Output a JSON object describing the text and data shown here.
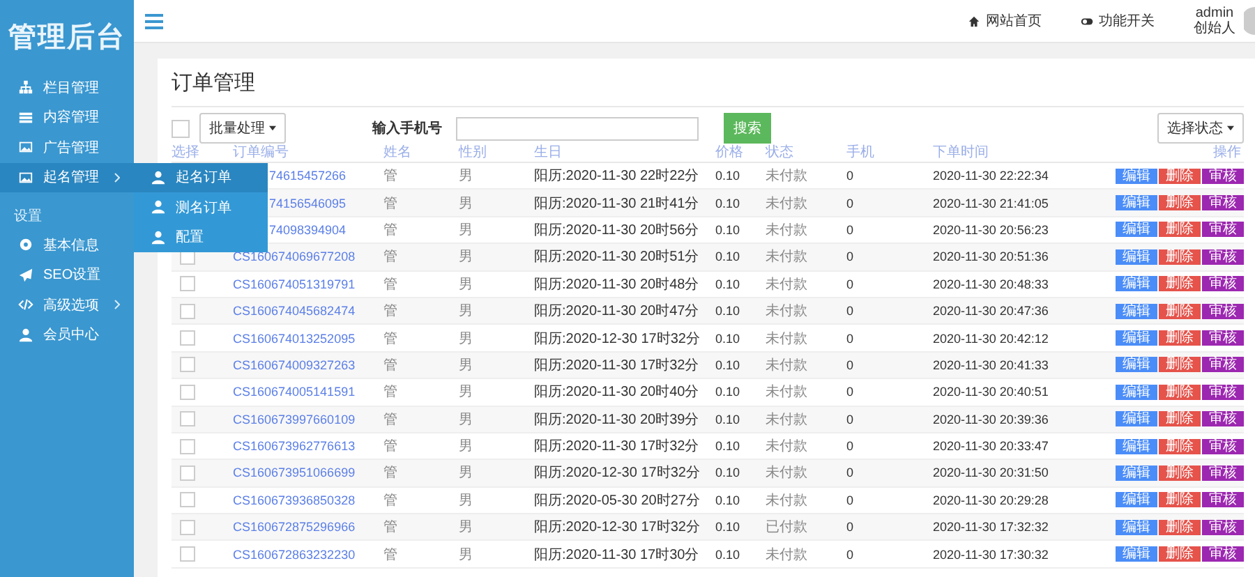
{
  "sidebar": {
    "logo": "管理后台",
    "items": [
      {
        "label": "栏目管理",
        "selected": false,
        "arrow": false
      },
      {
        "label": "内容管理",
        "selected": false,
        "arrow": false
      },
      {
        "label": "广告管理",
        "selected": false,
        "arrow": false
      },
      {
        "label": "起名管理",
        "selected": true,
        "arrow": true
      }
    ],
    "section": "设置",
    "settings": [
      {
        "label": "基本信息",
        "selected": false,
        "arrow": false
      },
      {
        "label": "SEO设置",
        "selected": false,
        "arrow": false
      },
      {
        "label": "高级选项",
        "selected": false,
        "arrow": true
      },
      {
        "label": "会员中心",
        "selected": false,
        "arrow": false
      }
    ],
    "flyout": [
      {
        "label": "起名订单",
        "selected": true
      },
      {
        "label": "测名订单",
        "selected": false
      },
      {
        "label": "配置",
        "selected": false
      }
    ]
  },
  "topbar": {
    "links": [
      {
        "label": "网站首页"
      },
      {
        "label": "功能开关"
      }
    ],
    "user": {
      "name": "admin",
      "role": "创始人"
    }
  },
  "page": {
    "title": "订单管理",
    "select_all": {
      "checked": false
    },
    "batch": "批量处理",
    "phone_label": "输入手机号",
    "search": "搜索",
    "status_filter": "选择状态"
  },
  "table": {
    "columns": [
      "选择",
      "订单编号",
      "姓名",
      "性别",
      "生日",
      "价格",
      "状态",
      "手机",
      "下单时间",
      "操作"
    ],
    "rows": [
      {
        "order_no": "74615457266",
        "name": "管",
        "gender": "男",
        "birthday": "阳历:2020-11-30 22时22分",
        "price": "0.10",
        "status": "未付款",
        "phone": "0",
        "time": "2020-11-30 22:22:34",
        "actions": [
          {
            "label": "编辑",
            "kind": "edit"
          },
          {
            "label": "删除",
            "kind": "delete"
          },
          {
            "label": "审核",
            "kind": "review"
          }
        ]
      },
      {
        "order_no": "74156546095",
        "name": "管",
        "gender": "男",
        "birthday": "阳历:2020-11-30 21时41分",
        "price": "0.10",
        "status": "未付款",
        "phone": "0",
        "time": "2020-11-30 21:41:05",
        "actions": [
          {
            "label": "编辑",
            "kind": "edit"
          },
          {
            "label": "删除",
            "kind": "delete"
          },
          {
            "label": "审核",
            "kind": "review"
          }
        ]
      },
      {
        "order_no": "74098394904",
        "name": "管",
        "gender": "男",
        "birthday": "阳历:2020-11-30 20时56分",
        "price": "0.10",
        "status": "未付款",
        "phone": "0",
        "time": "2020-11-30 20:56:23",
        "actions": [
          {
            "label": "编辑",
            "kind": "edit"
          },
          {
            "label": "删除",
            "kind": "delete"
          },
          {
            "label": "审核",
            "kind": "review"
          }
        ]
      },
      {
        "checked": false,
        "order_no": "CS160674069677208",
        "name": "管",
        "gender": "男",
        "birthday": "阳历:2020-11-30 20时51分",
        "price": "0.10",
        "status": "未付款",
        "phone": "0",
        "time": "2020-11-30 20:51:36",
        "actions": [
          {
            "label": "编辑",
            "kind": "edit"
          },
          {
            "label": "删除",
            "kind": "delete"
          },
          {
            "label": "审核",
            "kind": "review"
          }
        ]
      },
      {
        "checked": false,
        "order_no": "CS160674051319791",
        "name": "管",
        "gender": "男",
        "birthday": "阳历:2020-11-30 20时48分",
        "price": "0.10",
        "status": "未付款",
        "phone": "0",
        "time": "2020-11-30 20:48:33",
        "actions": [
          {
            "label": "编辑",
            "kind": "edit"
          },
          {
            "label": "删除",
            "kind": "delete"
          },
          {
            "label": "审核",
            "kind": "review"
          }
        ]
      },
      {
        "checked": false,
        "order_no": "CS160674045682474",
        "name": "管",
        "gender": "男",
        "birthday": "阳历:2020-11-30 20时47分",
        "price": "0.10",
        "status": "未付款",
        "phone": "0",
        "time": "2020-11-30 20:47:36",
        "actions": [
          {
            "label": "编辑",
            "kind": "edit"
          },
          {
            "label": "删除",
            "kind": "delete"
          },
          {
            "label": "审核",
            "kind": "review"
          }
        ]
      },
      {
        "checked": false,
        "order_no": "CS160674013252095",
        "name": "管",
        "gender": "男",
        "birthday": "阳历:2020-12-30 17时32分",
        "price": "0.10",
        "status": "未付款",
        "phone": "0",
        "time": "2020-11-30 20:42:12",
        "actions": [
          {
            "label": "编辑",
            "kind": "edit"
          },
          {
            "label": "删除",
            "kind": "delete"
          },
          {
            "label": "审核",
            "kind": "review"
          }
        ]
      },
      {
        "checked": false,
        "order_no": "CS160674009327263",
        "name": "管",
        "gender": "男",
        "birthday": "阳历:2020-11-30 17时32分",
        "price": "0.10",
        "status": "未付款",
        "phone": "0",
        "time": "2020-11-30 20:41:33",
        "actions": [
          {
            "label": "编辑",
            "kind": "edit"
          },
          {
            "label": "删除",
            "kind": "delete"
          },
          {
            "label": "审核",
            "kind": "review"
          }
        ]
      },
      {
        "checked": false,
        "order_no": "CS160674005141591",
        "name": "管",
        "gender": "男",
        "birthday": "阳历:2020-11-30 20时40分",
        "price": "0.10",
        "status": "未付款",
        "phone": "0",
        "time": "2020-11-30 20:40:51",
        "actions": [
          {
            "label": "编辑",
            "kind": "edit"
          },
          {
            "label": "删除",
            "kind": "delete"
          },
          {
            "label": "审核",
            "kind": "review"
          }
        ]
      },
      {
        "checked": false,
        "order_no": "CS160673997660109",
        "name": "管",
        "gender": "男",
        "birthday": "阳历:2020-11-30 20时39分",
        "price": "0.10",
        "status": "未付款",
        "phone": "0",
        "time": "2020-11-30 20:39:36",
        "actions": [
          {
            "label": "编辑",
            "kind": "edit"
          },
          {
            "label": "删除",
            "kind": "delete"
          },
          {
            "label": "审核",
            "kind": "review"
          }
        ]
      },
      {
        "checked": false,
        "order_no": "CS160673962776613",
        "name": "管",
        "gender": "男",
        "birthday": "阳历:2020-11-30 17时32分",
        "price": "0.10",
        "status": "未付款",
        "phone": "0",
        "time": "2020-11-30 20:33:47",
        "actions": [
          {
            "label": "编辑",
            "kind": "edit"
          },
          {
            "label": "删除",
            "kind": "delete"
          },
          {
            "label": "审核",
            "kind": "review"
          }
        ]
      },
      {
        "checked": false,
        "order_no": "CS160673951066699",
        "name": "管",
        "gender": "男",
        "birthday": "阳历:2020-12-30 17时32分",
        "price": "0.10",
        "status": "未付款",
        "phone": "0",
        "time": "2020-11-30 20:31:50",
        "actions": [
          {
            "label": "编辑",
            "kind": "edit"
          },
          {
            "label": "删除",
            "kind": "delete"
          },
          {
            "label": "审核",
            "kind": "review"
          }
        ]
      },
      {
        "checked": false,
        "order_no": "CS160673936850328",
        "name": "管",
        "gender": "男",
        "birthday": "阳历:2020-05-30 20时27分",
        "price": "0.10",
        "status": "未付款",
        "phone": "0",
        "time": "2020-11-30 20:29:28",
        "actions": [
          {
            "label": "编辑",
            "kind": "edit"
          },
          {
            "label": "删除",
            "kind": "delete"
          },
          {
            "label": "审核",
            "kind": "review"
          }
        ]
      },
      {
        "checked": false,
        "order_no": "CS160672875296966",
        "name": "管",
        "gender": "男",
        "birthday": "阳历:2020-12-30 17时32分",
        "price": "0.10",
        "status": "已付款",
        "phone": "0",
        "time": "2020-11-30 17:32:32",
        "actions": [
          {
            "label": "编辑",
            "kind": "edit"
          },
          {
            "label": "删除",
            "kind": "delete"
          },
          {
            "label": "审核",
            "kind": "review"
          }
        ]
      },
      {
        "checked": false,
        "order_no": "CS160672863232230",
        "name": "管",
        "gender": "男",
        "birthday": "阳历:2020-11-30 17时30分",
        "price": "0.10",
        "status": "未付款",
        "phone": "0",
        "time": "2020-11-30 17:30:32",
        "actions": [
          {
            "label": "编辑",
            "kind": "edit"
          },
          {
            "label": "删除",
            "kind": "delete"
          },
          {
            "label": "审核",
            "kind": "review"
          }
        ]
      }
    ]
  }
}
